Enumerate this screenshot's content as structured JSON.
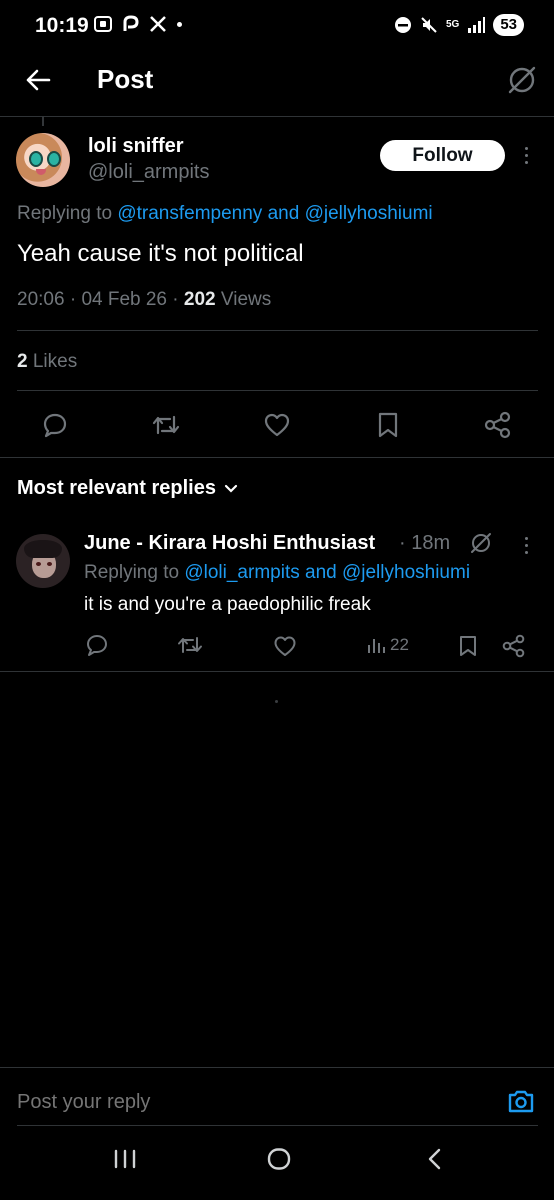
{
  "status_bar": {
    "time": "10:19",
    "battery": "53",
    "network": "5G"
  },
  "header": {
    "title": "Post"
  },
  "post": {
    "author_name": "loli sniffer",
    "author_handle": "@loli_armpits",
    "follow_label": "Follow",
    "replying_prefix": "Replying to",
    "replying_to_1": "@transfempenny",
    "replying_and": "and",
    "replying_to_2": "@jellyhoshiumi",
    "text": "Yeah cause it's not political",
    "time": "20:06",
    "date": "04 Feb 26",
    "views_count": "202",
    "views_label": "Views",
    "likes_count": "2",
    "likes_label": "Likes"
  },
  "replies_section": {
    "title": "Most relevant replies"
  },
  "reply": {
    "author_name": "June - Kirara Hoshi Enthusiast",
    "time": "· 18m",
    "replying_prefix": "Replying to",
    "replying_to_1": "@loli_armpits",
    "replying_and": "and",
    "replying_to_2": "@jellyhoshiumi",
    "text": "it is and you're a paedophilic freak",
    "views": "22"
  },
  "composer": {
    "placeholder": "Post your reply"
  },
  "colors": {
    "background": "#000000",
    "accent": "#1d9bf0",
    "muted": "#71767b",
    "divider": "#2f3336"
  },
  "icons": {
    "back": "arrow-left-icon",
    "grok": "grok-icon",
    "reply": "comment-icon",
    "repost": "repost-icon",
    "like": "heart-icon",
    "bookmark": "bookmark-icon",
    "share": "share-icon",
    "camera": "camera-icon"
  }
}
